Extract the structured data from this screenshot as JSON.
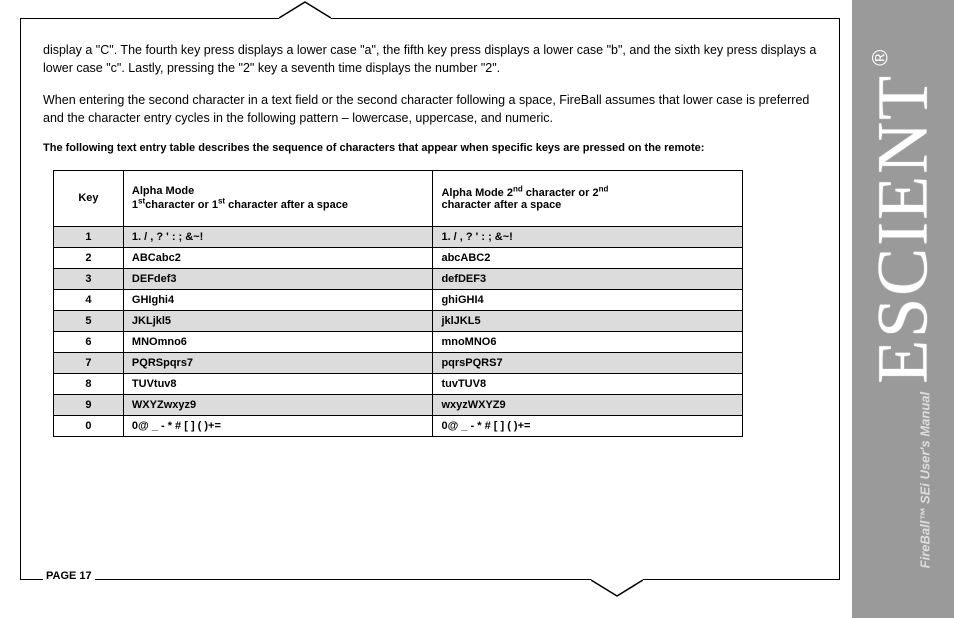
{
  "sidebar": {
    "brand": "ESCIENT",
    "registered": "®",
    "subtitle": "FireBall™ SEi User's Manual"
  },
  "paragraphs": {
    "p1": "display a \"C\".  The fourth key press displays a lower case \"a\", the fifth key press displays a lower case \"b\", and the sixth key press displays a lower case \"c\".  Lastly, pressing the \"2\" key a seventh time displays the number \"2\".",
    "p2": "When entering the second character in a text field or the second character following a space, FireBall assumes that lower case is preferred and the character entry cycles in the following pattern – lowercase, uppercase, and numeric.",
    "intro_bold": "The following text entry table describes the sequence of characters that appear when specific keys are pressed on the remote:"
  },
  "table": {
    "headers": {
      "key": "Key",
      "col1_line1": "Alpha Mode",
      "col1_line2a": "1",
      "col1_line2b": "character or 1",
      "col1_line2c": " character after a space",
      "col2_line1a": "Alpha Mode 2",
      "col2_line1b": " character or 2",
      "col2_line2": "character after a space",
      "sup_st": "st",
      "sup_nd": "nd"
    },
    "rows": [
      {
        "key": "1",
        "c1": "1. / , ? ' : ; &~!",
        "c2": "1. / , ? ' : ; &~!",
        "shade": true
      },
      {
        "key": "2",
        "c1": "ABCabc2",
        "c2": "abcABC2",
        "shade": false
      },
      {
        "key": "3",
        "c1": "DEFdef3",
        "c2": "defDEF3",
        "shade": true
      },
      {
        "key": "4",
        "c1": "GHIghi4",
        "c2": "ghiGHI4",
        "shade": false
      },
      {
        "key": "5",
        "c1": "JKLjkl5",
        "c2": "jklJKL5",
        "shade": true
      },
      {
        "key": "6",
        "c1": "MNOmno6",
        "c2": "mnoMNO6",
        "shade": false
      },
      {
        "key": "7",
        "c1": "PQRSpqrs7",
        "c2": "pqrsPQRS7",
        "shade": true
      },
      {
        "key": "8",
        "c1": "TUVtuv8",
        "c2": "tuvTUV8",
        "shade": false
      },
      {
        "key": "9",
        "c1": "WXYZwxyz9",
        "c2": "wxyzWXYZ9",
        "shade": true
      },
      {
        "key": "0",
        "c1": "0@ _ - * # [ ] ( )+=",
        "c2": "0@ _ - * # [ ] ( )+=",
        "shade": false
      }
    ]
  },
  "footer": {
    "page_label": "PAGE 17"
  }
}
